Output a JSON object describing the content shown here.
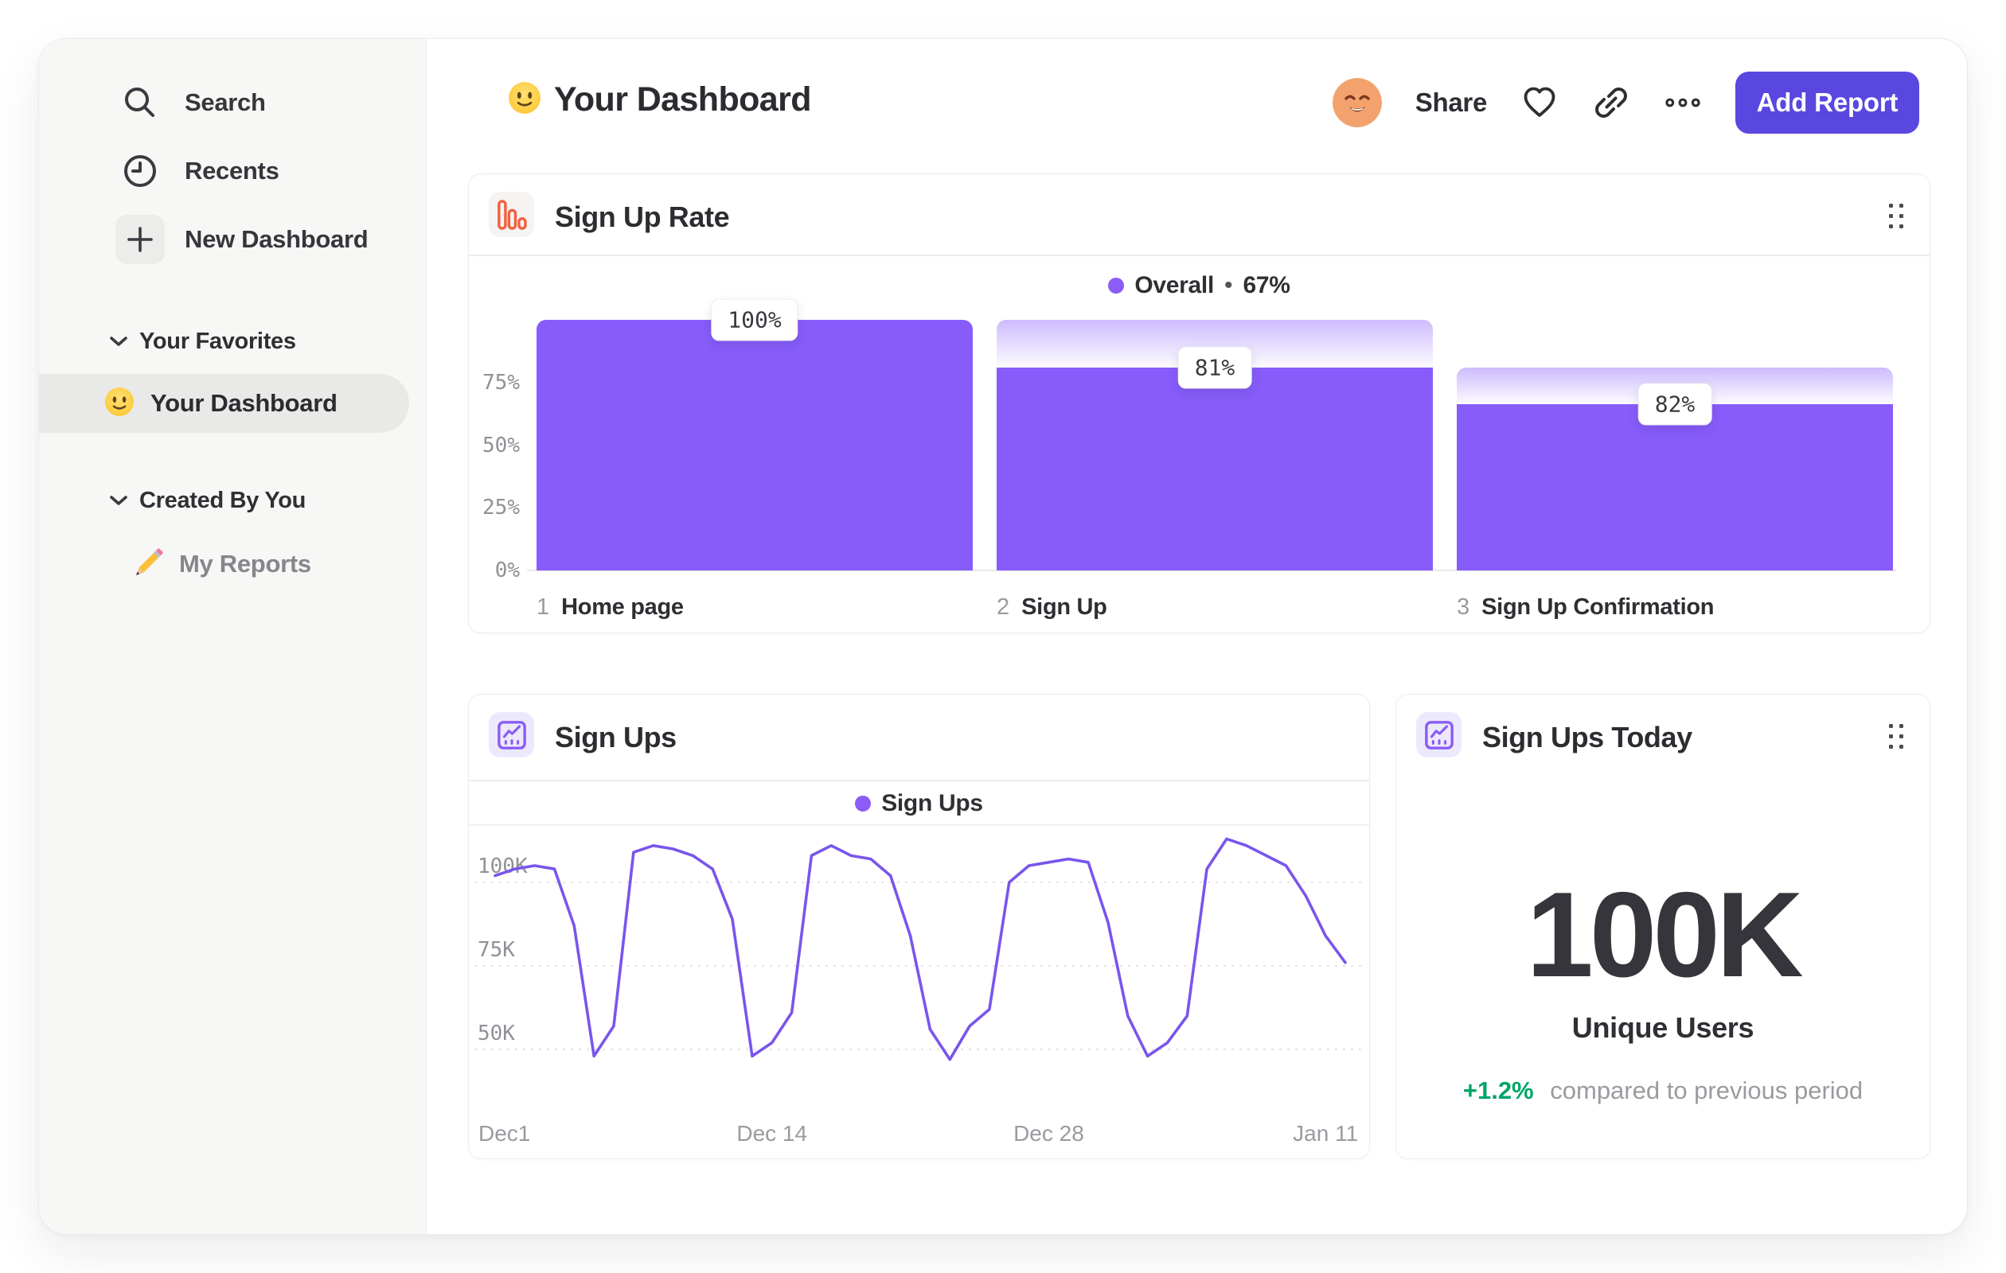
{
  "sidebar": {
    "nav": [
      {
        "icon": "search-icon",
        "label": "Search"
      },
      {
        "icon": "clock-icon",
        "label": "Recents"
      },
      {
        "icon": "plus-icon",
        "label": "New Dashboard"
      }
    ],
    "sections": [
      {
        "title": "Your Favorites",
        "items": [
          {
            "icon": "smiley-emoji",
            "label": "Your Dashboard",
            "active": true
          }
        ]
      },
      {
        "title": "Created By You",
        "items": [
          {
            "icon": "pencil-emoji",
            "label": "My Reports",
            "active": false
          }
        ]
      }
    ]
  },
  "header": {
    "title": "Your Dashboard",
    "share_label": "Share",
    "add_report_label": "Add Report"
  },
  "funnel_card": {
    "title": "Sign Up Rate",
    "legend_label": "Overall",
    "legend_separator": "•",
    "legend_value": "67%"
  },
  "line_card": {
    "title": "Sign Ups",
    "legend_label": "Sign Ups"
  },
  "today_card": {
    "title": "Sign Ups Today",
    "value": "100K",
    "subtitle": "Unique Users",
    "delta": "+1.2%",
    "delta_caption": "compared to previous period"
  },
  "chart_data": [
    {
      "type": "bar",
      "variant": "funnel",
      "title": "Sign Up Rate",
      "legend": "Overall • 67%",
      "legend_position": "top-center",
      "ylim": [
        0,
        100
      ],
      "yticks": [
        {
          "label": "75%",
          "value": 75
        },
        {
          "label": "50%",
          "value": 50
        },
        {
          "label": "25%",
          "value": 25
        },
        {
          "label": "0%",
          "value": 0
        }
      ],
      "steps": [
        {
          "number": "1",
          "category": "Home page",
          "conversion_label": "100%",
          "conversion_pct": 100,
          "cumulative_pct": 100,
          "ghost_from_pct": 100
        },
        {
          "number": "2",
          "category": "Sign Up",
          "conversion_label": "81%",
          "conversion_pct": 81,
          "cumulative_pct": 81,
          "ghost_from_pct": 100
        },
        {
          "number": "3",
          "category": "Sign Up Confirmation",
          "conversion_label": "82%",
          "conversion_pct": 82,
          "cumulative_pct": 66.4,
          "ghost_from_pct": 81
        }
      ]
    },
    {
      "type": "line",
      "title": "Sign Ups",
      "legend": "Sign Ups",
      "grid": "dashed-horizontal",
      "ylim_thousands": [
        40,
        118
      ],
      "yticks": [
        {
          "label": "100K",
          "value": 100
        },
        {
          "label": "75K",
          "value": 75
        },
        {
          "label": "50K",
          "value": 50
        }
      ],
      "xticks": [
        {
          "label": "Dec1",
          "day": 0
        },
        {
          "label": "Dec 14",
          "day": 14
        },
        {
          "label": "Dec 28",
          "day": 28
        },
        {
          "label": "Jan 11",
          "day": 42
        }
      ],
      "x_days_span": 43,
      "values_thousands": [
        102,
        104,
        105,
        104,
        87,
        48,
        57,
        109,
        111,
        110,
        108,
        104,
        89,
        48,
        52,
        61,
        108,
        111,
        108,
        107,
        102,
        84,
        56,
        47,
        57,
        62,
        100,
        105,
        106,
        107,
        106,
        88,
        60,
        48,
        52,
        60,
        104,
        113,
        111,
        108,
        105,
        96,
        84,
        76
      ]
    },
    {
      "type": "single-value",
      "title": "Sign Ups Today",
      "value": "100K",
      "label": "Unique Users",
      "change_pct": "+1.2%",
      "change_caption": "compared to previous period"
    }
  ],
  "colors": {
    "bar_purple": "#875cfa",
    "line_purple": "#7a55ec",
    "legend_dot_purple": "#8b5cf6",
    "button_indigo": "#5947e0",
    "funnel_icon_orange": "#f2603f",
    "positive_green": "#00a568",
    "sidebar_bg": "#f7f7f6",
    "axis_text_gray": "#90909 6"
  }
}
